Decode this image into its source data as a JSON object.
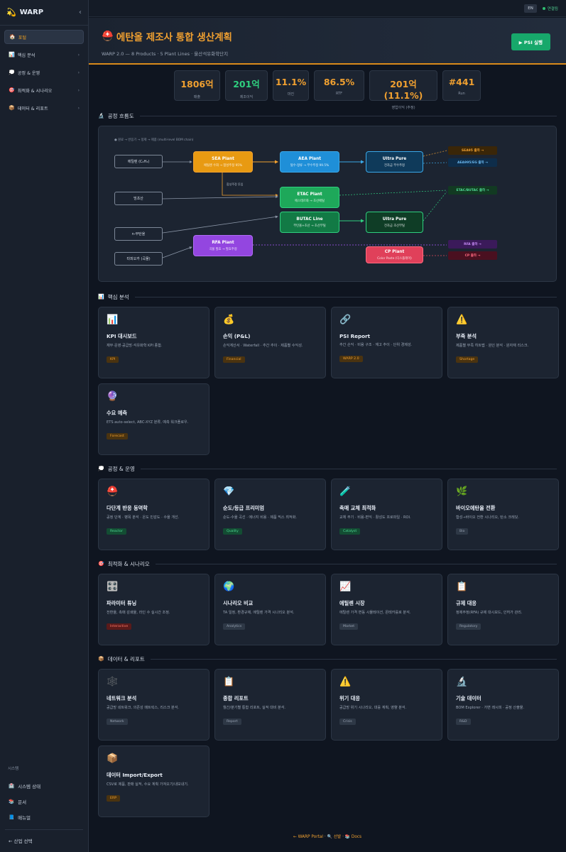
{
  "sidebar": {
    "brand": "WARP",
    "collapse_glyph": "‹",
    "items": [
      {
        "icon": "🏠",
        "label": "포털",
        "active": true
      },
      {
        "icon": "📊",
        "label": "핵심 분석"
      },
      {
        "icon": "💭",
        "label": "공정 & 운영"
      },
      {
        "icon": "🎯",
        "label": "최적화 & 시나리오"
      },
      {
        "icon": "📦",
        "label": "데이터 & 리포트"
      }
    ],
    "system_title": "시스템",
    "system_items": [
      {
        "icon": "🏥",
        "label": "시스템 상태"
      },
      {
        "icon": "📚",
        "label": "문서"
      },
      {
        "icon": "📘",
        "label": "매뉴얼"
      }
    ],
    "back_label": "← 산업 선택"
  },
  "topbar": {
    "lang": "EN",
    "connection": "연결됨"
  },
  "hero": {
    "title": "에탄올 제조사 통합 생산계획",
    "subtitle": "WARP 2.0 — 8 Products · 5 Plant Lines · 울산석유화학단지",
    "psi_button": "▶ PSI 실행"
  },
  "kpis": [
    {
      "value": "1806억",
      "label": "매출",
      "color": "#f0a030"
    },
    {
      "value": "201억",
      "label": "제조이익",
      "color": "#2fcf7f"
    },
    {
      "value": "11.1%",
      "label": "마진",
      "color": "#f0a030"
    },
    {
      "value": "86.5%",
      "label": "RTF",
      "color": "#f0a030"
    },
    {
      "value": "201억 (11.1%)",
      "label": "영업이익 (추정)",
      "color": "#f0a030"
    },
    {
      "value": "#441",
      "label": "Run",
      "color": "#f0a030"
    }
  ],
  "flow": {
    "section_title": "공정 흐름도",
    "legend": "● 원료 → 반응기 → 정제 → 제품 (multi-level BOM chain)",
    "sources": [
      "에틸렌 (C₂H₄)",
      "빙초산",
      "n-부탄올",
      "타피오카 (곡물)"
    ],
    "nodes": [
      {
        "title": "SEA Plant",
        "sub": "에틸렌 수화 → 합성주정 95%"
      },
      {
        "title": "AEA Plant",
        "sub": "탈수·정류 → 무수주정 99.5%"
      },
      {
        "title": "Ultra Pure",
        "sub": "전자급 무수주정"
      },
      {
        "title": "ETAC Plant",
        "sub": "에스테르화 → 초산에틸"
      },
      {
        "title": "BUTAC Line",
        "sub": "부탄올+초산 → 초산부틸"
      },
      {
        "title": "Ultra Pure",
        "sub": "전자급 초산부틸"
      },
      {
        "title": "RFA Plant",
        "sub": "곡물 발효 → 발효주정"
      },
      {
        "title": "CP Plant",
        "sub": "Color Paste (디스플레이)"
      }
    ],
    "edge_label": "합성주정 투입",
    "outputs": [
      "SEA95 출하 →",
      "AEA995/EG 출하 →",
      "ETAC/BUTAC 출하 →",
      "RFA 출하 →",
      "CP 출하 →"
    ]
  },
  "sections": [
    {
      "icon": "📊",
      "title": "핵심 분석",
      "cards": [
        {
          "icon": "📊",
          "title": "KPI 대시보드",
          "desc": "재무·운영·공급망·석유화학 KPI 종합.",
          "tag": "KPI",
          "tag_bg": "#4a3310",
          "tag_fg": "#f0a030"
        },
        {
          "icon": "💰",
          "title": "손익 (P&L)",
          "desc": "손익계산서 · Waterfall · 추간 추이 · 제품별 수익성.",
          "tag": "Financial",
          "tag_bg": "#4a3310",
          "tag_fg": "#f0a030"
        },
        {
          "icon": "🔗",
          "title": "PSI Report",
          "desc": "추간 손익 · 비용 구조 · 재고 추이 · 단위 경제성.",
          "tag": "WARP 2.0",
          "tag_bg": "#4a3310",
          "tag_fg": "#f0a030"
        },
        {
          "icon": "⚠️",
          "title": "부족 분석",
          "desc": "제품별 부족 히트맵 · 원인 분석 · 원자재 리스크.",
          "tag": "Shortage",
          "tag_bg": "#4a3310",
          "tag_fg": "#f0a030"
        },
        {
          "icon": "🔮",
          "title": "수요 예측",
          "desc": "ETS auto-select, ABC-XYZ 분류, 예측 워크플로우.",
          "tag": "Forecast",
          "tag_bg": "#4a3310",
          "tag_fg": "#f0a030"
        }
      ]
    },
    {
      "icon": "💭",
      "title": "공정 & 운영",
      "cards": [
        {
          "icon": "⛑️",
          "title": "다단계 반응 동역학",
          "desc": "공정 단계 · 병목 분석 · 온도 민감도 · 수율 개선.",
          "tag": "Reactor",
          "tag_bg": "#134d33",
          "tag_fg": "#4fdc95"
        },
        {
          "icon": "💎",
          "title": "순도/등급 프리미엄",
          "desc": "순도-수율 곡선 · 에너지 비용 · 제품 믹스 최적화.",
          "tag": "Quality",
          "tag_bg": "#134d33",
          "tag_fg": "#4fdc95"
        },
        {
          "icon": "🧪",
          "title": "촉매 교체 최적화",
          "desc": "교체 주기 · 비용-편익 · 활성도 프로파일 · ROI.",
          "tag": "Catalyst",
          "tag_bg": "#134d33",
          "tag_fg": "#4fdc95"
        },
        {
          "icon": "🌿",
          "title": "바이오에탄올 전환",
          "desc": "합성→바이오 전환 시나리오, 탄소 크레딧.",
          "tag": "Bio",
          "tag_bg": "#2e3846",
          "tag_fg": "#9aa5b5"
        }
      ]
    },
    {
      "icon": "🎯",
      "title": "최적화 & 시나리오",
      "cards": [
        {
          "icon": "🎛️",
          "title": "파라미터 튜닝",
          "desc": "전환율, 촉매 감쇄율, 라인 수 실시간 조정.",
          "tag": "Interactive",
          "tag_bg": "#5a1a1a",
          "tag_fg": "#ff7a6a"
        },
        {
          "icon": "🌍",
          "title": "시나리오 비교",
          "desc": "TA 일정, 환경규제, 에틸렌 가격 시나리오 분석.",
          "tag": "Analytics",
          "tag_bg": "#2e3846",
          "tag_fg": "#9aa5b5"
        },
        {
          "icon": "📈",
          "title": "에틸렌 시장",
          "desc": "에틸렌 가격 변동 시뮬레이션, 몬테카를로 분석.",
          "tag": "Market",
          "tag_bg": "#2e3846",
          "tag_fg": "#9aa5b5"
        },
        {
          "icon": "📋",
          "title": "규제 대응",
          "desc": "정제주정(RFA) 규제 대시보드, 인허가 관리.",
          "tag": "Regulatory",
          "tag_bg": "#2e3846",
          "tag_fg": "#9aa5b5"
        }
      ]
    },
    {
      "icon": "📦",
      "title": "데이터 & 리포트",
      "cards": [
        {
          "icon": "🕸️",
          "title": "네트워크 분석",
          "desc": "공급망 네트워크, 의존성 매트릭스, 리스크 분석.",
          "tag": "Network",
          "tag_bg": "#2e3846",
          "tag_fg": "#9aa5b5"
        },
        {
          "icon": "📋",
          "title": "종합 리포트",
          "desc": "월간/분기별 통합 리포트, 실적 대비 분석.",
          "tag": "Report",
          "tag_bg": "#2e3846",
          "tag_fg": "#9aa5b5"
        },
        {
          "icon": "⚠️",
          "title": "위기 대응",
          "desc": "공급망 위기 시나리오, 대응 계획, 영향 분석.",
          "tag": "Crisis",
          "tag_bg": "#2e3846",
          "tag_fg": "#9aa5b5"
        },
        {
          "icon": "🔬",
          "title": "기술 데이터",
          "desc": "BOM Explorer · 가변 레시피 · 공정 산출물.",
          "tag": "R&D",
          "tag_bg": "#2e3846",
          "tag_fg": "#9aa5b5"
        },
        {
          "icon": "📦",
          "title": "데이터 Import/Export",
          "desc": "CSV로 제품, 판매 실적, 수요 계획 가져오기/내보내기.",
          "tag": "ERP",
          "tag_bg": "#4a3310",
          "tag_fg": "#f0a030"
        }
      ]
    }
  ],
  "footer": "← WARP Portal · 🔍 선발 · 📚 Docs"
}
